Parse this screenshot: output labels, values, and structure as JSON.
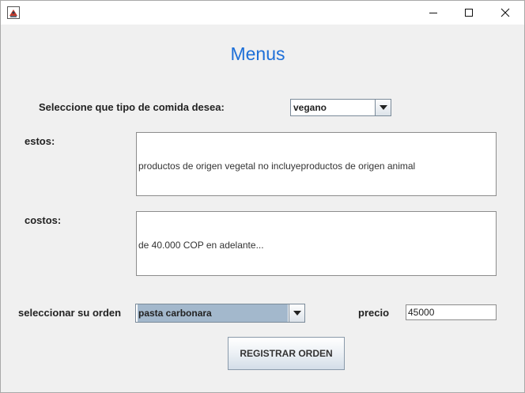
{
  "window": {
    "icon": "java-app-icon",
    "controls": {
      "minimize_icon": "minimize-icon",
      "maximize_icon": "maximize-icon",
      "close_icon": "close-icon"
    }
  },
  "form": {
    "title": "Menus",
    "title_color": "#1d6fd8",
    "tipo_label": "Seleccione que tipo de comida desea:",
    "tipo_selected": "vegano",
    "estos_label": "estos:",
    "estos_text": "productos de origen vegetal no incluyeproductos de origen animal",
    "costos_label": "costos:",
    "costos_text": "de 40.000 COP en adelante...",
    "orden_label": "seleccionar su orden",
    "orden_selected": "pasta carbonara",
    "precio_label": "precio",
    "precio_value": "45000",
    "register_button": "REGISTRAR ORDEN"
  }
}
